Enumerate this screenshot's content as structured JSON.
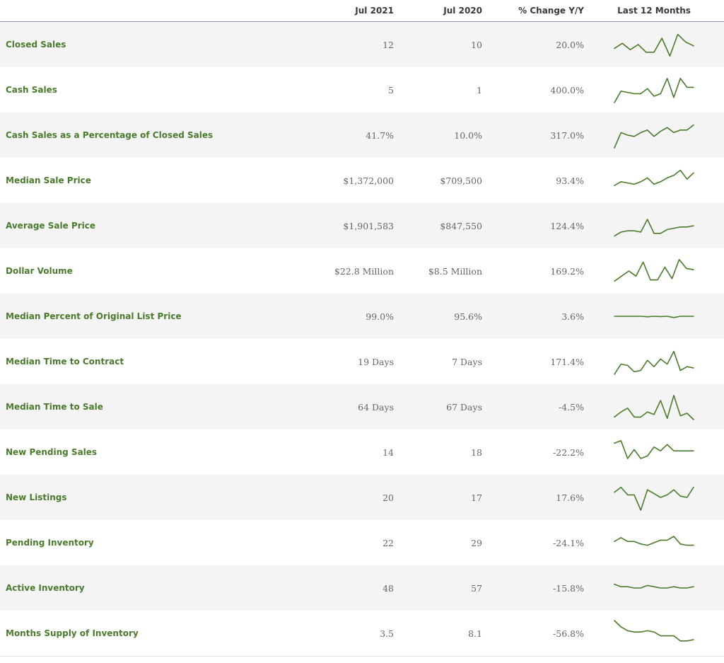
{
  "header": {
    "col_current": "Jul 2021",
    "col_previous": "Jul 2020",
    "col_change": "% Change Y/Y",
    "col_spark": "Last 12 Months"
  },
  "colors": {
    "accent": "#4a7b2d",
    "header_rule": "#8b8fb3",
    "stripe": "#f4f4f4"
  },
  "rows": [
    {
      "label": "Closed Sales",
      "current": "12",
      "previous": "10",
      "change": "20.0%",
      "spark": [
        0.35,
        0.55,
        0.3,
        0.5,
        0.2,
        0.2,
        0.75,
        0.05,
        0.9,
        0.6,
        0.45
      ]
    },
    {
      "label": "Cash Sales",
      "current": "5",
      "previous": "1",
      "change": "400.0%",
      "spark": [
        0.0,
        0.45,
        0.4,
        0.35,
        0.35,
        0.55,
        0.25,
        0.35,
        0.95,
        0.2,
        0.95,
        0.6,
        0.6
      ]
    },
    {
      "label": "Cash Sales as a Percentage of Closed Sales",
      "current": "41.7%",
      "previous": "10.0%",
      "change": "317.0%",
      "spark": [
        0.0,
        0.6,
        0.5,
        0.45,
        0.6,
        0.7,
        0.45,
        0.65,
        0.8,
        0.6,
        0.7,
        0.7,
        0.9
      ]
    },
    {
      "label": "Median Sale Price",
      "current": "$1,372,000",
      "previous": "$709,500",
      "change": "93.4%",
      "spark": [
        0.3,
        0.45,
        0.4,
        0.35,
        0.45,
        0.6,
        0.35,
        0.45,
        0.6,
        0.7,
        0.9,
        0.55,
        0.8
      ]
    },
    {
      "label": "Average Sale Price",
      "current": "$1,901,583",
      "previous": "$847,550",
      "change": "124.4%",
      "spark": [
        0.1,
        0.25,
        0.3,
        0.3,
        0.25,
        0.75,
        0.2,
        0.2,
        0.35,
        0.4,
        0.45,
        0.45,
        0.5
      ]
    },
    {
      "label": "Dollar Volume",
      "current": "$22.8 Million",
      "previous": "$8.5 Million",
      "change": "169.2%",
      "spark": [
        0.1,
        0.3,
        0.5,
        0.3,
        0.85,
        0.15,
        0.15,
        0.65,
        0.2,
        0.95,
        0.6,
        0.55
      ]
    },
    {
      "label": "Median Percent of Original List Price",
      "current": "99.0%",
      "previous": "95.6%",
      "change": "3.6%",
      "spark": [
        0.5,
        0.5,
        0.5,
        0.5,
        0.5,
        0.48,
        0.5,
        0.49,
        0.5,
        0.45,
        0.5,
        0.5,
        0.5
      ]
    },
    {
      "label": "Median Time to Contract",
      "current": "19 Days",
      "previous": "7 Days",
      "change": "171.4%",
      "spark": [
        0.0,
        0.4,
        0.35,
        0.1,
        0.15,
        0.55,
        0.3,
        0.6,
        0.4,
        0.9,
        0.15,
        0.3,
        0.25
      ]
    },
    {
      "label": "Median Time to Sale",
      "current": "64 Days",
      "previous": "67 Days",
      "change": "-4.5%",
      "spark": [
        0.1,
        0.3,
        0.45,
        0.1,
        0.1,
        0.3,
        0.2,
        0.75,
        0.05,
        0.95,
        0.15,
        0.25,
        0.0
      ]
    },
    {
      "label": "New Pending Sales",
      "current": "14",
      "previous": "18",
      "change": "-22.2%",
      "spark": [
        0.85,
        0.95,
        0.25,
        0.6,
        0.25,
        0.35,
        0.7,
        0.55,
        0.8,
        0.55,
        0.55,
        0.55,
        0.55
      ]
    },
    {
      "label": "New Listings",
      "current": "20",
      "previous": "17",
      "change": "17.6%",
      "spark": [
        0.7,
        0.9,
        0.6,
        0.6,
        0.0,
        0.8,
        0.65,
        0.5,
        0.6,
        0.8,
        0.55,
        0.5,
        0.9
      ]
    },
    {
      "label": "Pending Inventory",
      "current": "22",
      "previous": "29",
      "change": "-24.1%",
      "spark": [
        0.55,
        0.7,
        0.55,
        0.55,
        0.45,
        0.4,
        0.5,
        0.6,
        0.6,
        0.75,
        0.45,
        0.4,
        0.4
      ]
    },
    {
      "label": "Active Inventory",
      "current": "48",
      "previous": "57",
      "change": "-15.8%",
      "spark": [
        0.65,
        0.55,
        0.55,
        0.5,
        0.5,
        0.6,
        0.55,
        0.5,
        0.5,
        0.55,
        0.5,
        0.5,
        0.55
      ]
    },
    {
      "label": "Months Supply of Inventory",
      "current": "3.5",
      "previous": "8.1",
      "change": "-56.8%",
      "spark": [
        1.0,
        0.75,
        0.6,
        0.55,
        0.55,
        0.6,
        0.55,
        0.4,
        0.4,
        0.4,
        0.2,
        0.2,
        0.25
      ]
    }
  ]
}
